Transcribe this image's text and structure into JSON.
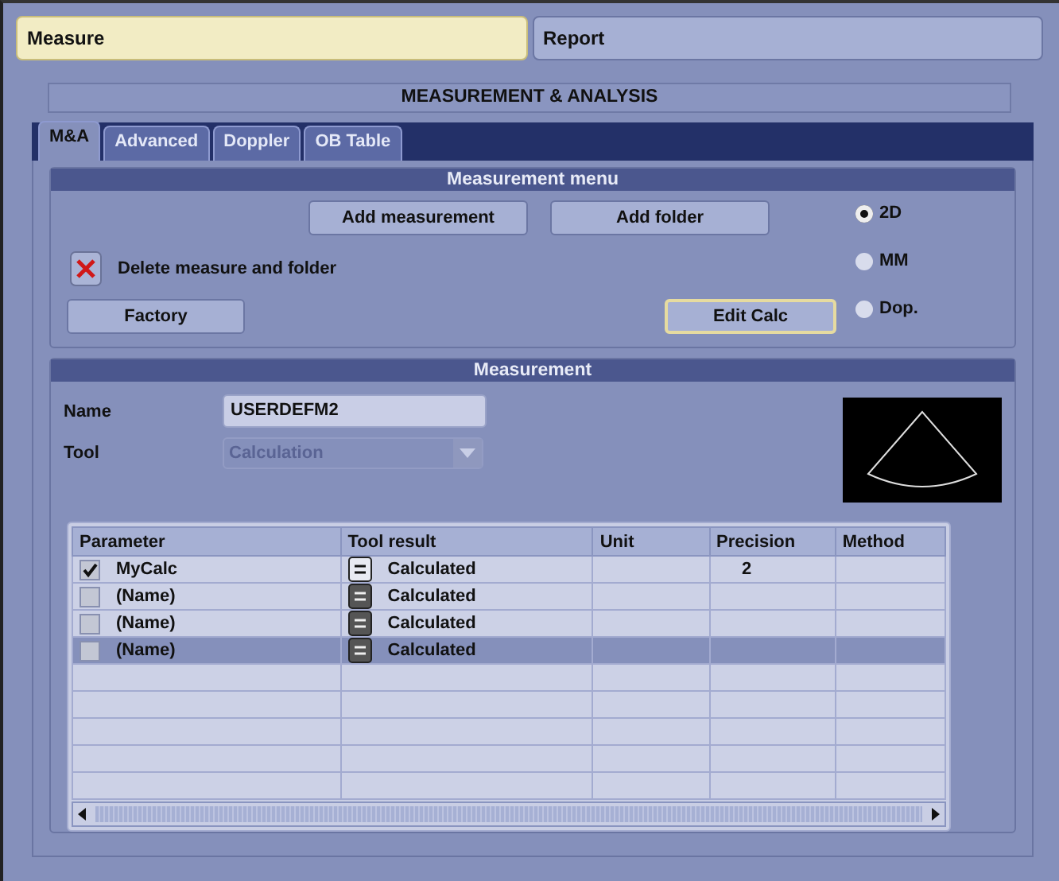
{
  "top_tabs": [
    {
      "label": "Measure",
      "selected": true
    },
    {
      "label": "Report",
      "selected": false
    }
  ],
  "title": "MEASUREMENT & ANALYSIS",
  "tabs": [
    {
      "label": "M&A",
      "selected": true
    },
    {
      "label": "Advanced",
      "selected": false
    },
    {
      "label": "Doppler",
      "selected": false
    },
    {
      "label": "OB Table",
      "selected": false
    }
  ],
  "measurement_menu": {
    "title": "Measurement menu",
    "add_measurement": {
      "label": "Add measurement",
      "focused": false
    },
    "add_folder": {
      "label": "Add folder",
      "focused": false
    },
    "delete": {
      "label": "Delete measure and folder"
    },
    "factory": {
      "label": "Factory",
      "focused": false
    },
    "edit_calc": {
      "label": "Edit Calc",
      "focused": true
    },
    "modes": [
      {
        "label": "2D",
        "selected": true
      },
      {
        "label": "MM",
        "selected": false
      },
      {
        "label": "Dop.",
        "selected": false
      }
    ]
  },
  "measurement": {
    "title": "Measurement",
    "name_label": "Name",
    "name_value": "USERDEFM2",
    "tool_label": "Tool",
    "tool_value": "Calculation",
    "table": {
      "columns": [
        "Parameter",
        "Tool result",
        "Unit",
        "Precision",
        "Method"
      ],
      "rows": [
        {
          "checked": true,
          "selected": false,
          "parameter": "MyCalc",
          "tool_result": "Calculated",
          "precision": "2"
        },
        {
          "checked": false,
          "selected": false,
          "parameter": "(Name)",
          "tool_result": "Calculated"
        },
        {
          "checked": false,
          "selected": false,
          "parameter": "(Name)",
          "tool_result": "Calculated"
        },
        {
          "checked": false,
          "selected": true,
          "parameter": "(Name)",
          "tool_result": "Calculated"
        }
      ]
    }
  }
}
